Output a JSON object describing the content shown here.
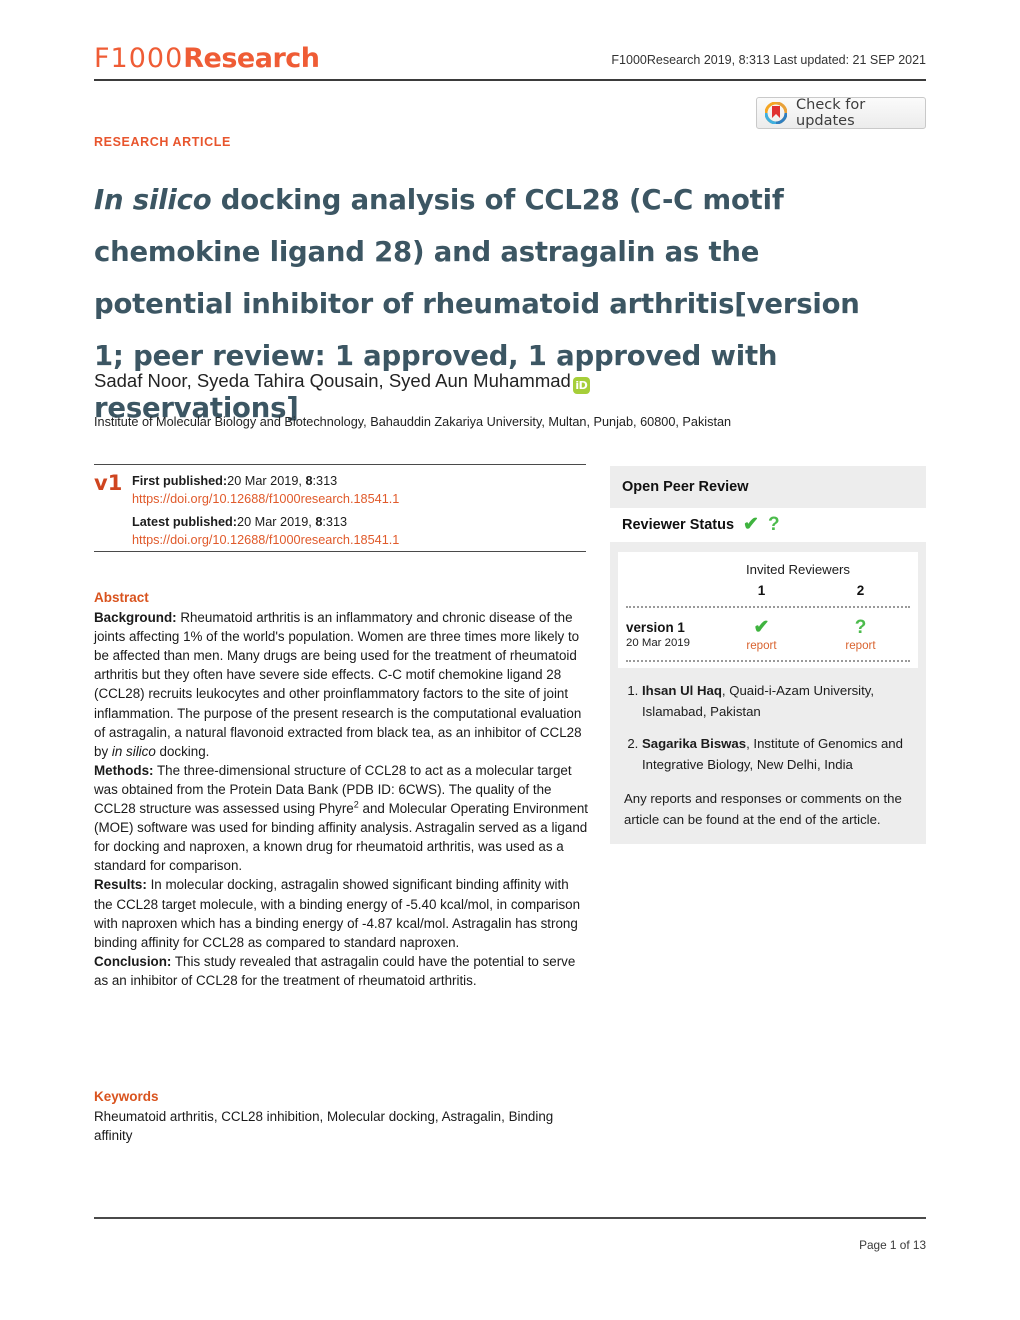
{
  "masthead": {
    "logo_primary": "F1000",
    "logo_secondary": "Research",
    "citation": "F1000Research 2019, 8:313 Last updated: 21 SEP 2021"
  },
  "crossmark": {
    "label": "Check for updates",
    "icon": "crossmark-bookmark-icon"
  },
  "article": {
    "kicker": "RESEARCH ARTICLE",
    "title_italic": "In silico",
    "title_main": " docking analysis of CCL28 (C-C motif chemokine ligand 28) and astragalin as the potential inhibitor of rheumatoid arthritis",
    "title_version": "[version 1; peer review: 1 approved, 1 approved with reservations]",
    "authors": "Sadaf Noor, Syeda Tahira Qousain, Syed Aun Muhammad",
    "orcid_label": "iD",
    "affiliation": "Institute of Molecular Biology and Biotechnology, Bahauddin Zakariya University, Multan, Punjab, 60800, Pakistan"
  },
  "publication": {
    "version_badge": "v1",
    "first_published_label": "First published:",
    "first_published_value": "20 Mar 2019, ",
    "first_published_vol": "8",
    "first_published_issue": ":313",
    "first_doi": "https://doi.org/10.12688/f1000research.18541.1",
    "latest_published_label": "Latest published:",
    "latest_published_value": "20 Mar 2019, ",
    "latest_published_vol": "8",
    "latest_published_issue": ":313",
    "latest_doi": "https://doi.org/10.12688/f1000research.18541.1"
  },
  "abstract": {
    "heading": "Abstract",
    "background_label": "Background:",
    "background_text": " Rheumatoid arthritis is an inflammatory and chronic disease of the joints affecting 1% of the world's population. Women are three times more likely to be affected than men. Many drugs are being used for the treatment of rheumatoid arthritis but they often have severe side effects. C-C motif chemokine ligand 28 (CCL28) recruits leukocytes and other proinflammatory factors to the site of joint inflammation. The purpose of the present research is the computational evaluation of astragalin, a natural flavonoid extracted from black tea, as an inhibitor of CCL28 by ",
    "background_italic": "in silico",
    "background_tail": " docking.",
    "methods_label": "Methods:",
    "methods_text_1": " The three-dimensional structure of CCL28 to act as a molecular target was obtained from the Protein Data Bank (PDB ID: 6CWS). The quality of the CCL28 structure was assessed using Phyre",
    "methods_sup": "2",
    "methods_text_2": " and Molecular Operating Environment (MOE) software was used for binding affinity analysis. Astragalin served as a ligand for docking and naproxen, a known drug for rheumatoid arthritis, was used as a standard for comparison.",
    "results_label": "Results:",
    "results_text": " In molecular docking, astragalin showed significant binding affinity with the CCL28 target molecule, with a binding energy of -5.40 kcal/mol, in comparison with naproxen which has a binding energy of -4.87 kcal/mol. Astragalin has strong binding affinity for CCL28 as compared to standard naproxen.",
    "conclusion_label": "Conclusion:",
    "conclusion_text": " This study revealed that astragalin could have the potential to serve as an inhibitor of CCL28 for the treatment of rheumatoid arthritis."
  },
  "keywords": {
    "heading": "Keywords",
    "text": "Rheumatoid arthritis, CCL28 inhibition, Molecular docking, Astragalin, Binding affinity"
  },
  "peer_review": {
    "panel_title": "Open Peer Review",
    "status_label": "Reviewer Status",
    "status_icons": [
      "check-icon",
      "question-icon"
    ],
    "invited_header": "Invited Reviewers",
    "columns": [
      "1",
      "2"
    ],
    "version_name": "version 1",
    "version_date": "20 Mar 2019",
    "marks": [
      {
        "icon": "check-icon",
        "glyph": "✔",
        "color": "#3fb33f",
        "report_label": "report"
      },
      {
        "icon": "question-icon",
        "glyph": "?",
        "color": "#4cbb4c",
        "report_label": "report"
      }
    ],
    "reviewers": [
      {
        "name": "Ihsan Ul Haq",
        "affiliation": ", Quaid-i-Azam University, Islamabad, Pakistan"
      },
      {
        "name": "Sagarika Biswas",
        "affiliation": ", Institute of Genomics and Integrative Biology, New Delhi, India"
      }
    ],
    "note": "Any reports and responses or comments on the article can be found at the end of the article."
  },
  "footer": {
    "page_number": "Page 1 of 13"
  },
  "colors": {
    "brand_orange": "#ef5c35",
    "title_slate": "#3c5663",
    "link_orange": "#e05a2b",
    "approved_green": "#3fb33f",
    "panel_gray": "#ededed",
    "orcid_green": "#a6ce39"
  }
}
